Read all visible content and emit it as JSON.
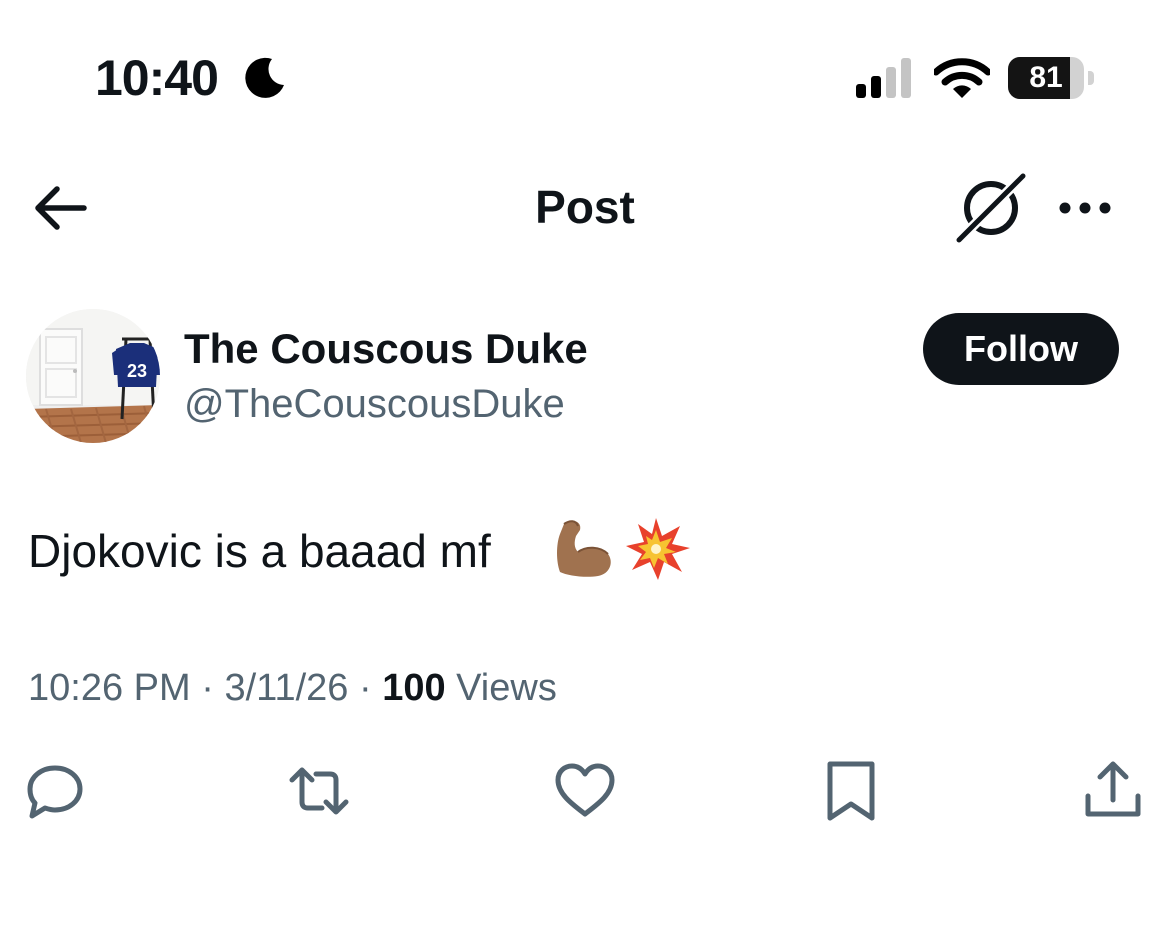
{
  "status_bar": {
    "time": "10:40",
    "focus_icon": "moon-icon",
    "signal_icon": "cellular-signal-icon",
    "wifi_icon": "wifi-icon",
    "battery_percent": "81",
    "battery_level": 0.81
  },
  "nav": {
    "back_icon": "back-arrow-icon",
    "title": "Post",
    "grok_icon": "grok-icon",
    "more_icon": "more-dots-icon"
  },
  "author": {
    "display_name": "The Couscous Duke",
    "handle": "@TheCouscousDuke",
    "avatar_jersey_number": "23",
    "follow_label": "Follow"
  },
  "tweet": {
    "text": "Djokovic is a baaad mf",
    "emojis": [
      "flexed-biceps-icon",
      "collision-icon"
    ],
    "time": "10:26 PM",
    "sep1": " · ",
    "date": "3/11/26",
    "sep2": " · ",
    "views_count": "100",
    "views_label": " Views"
  },
  "actions": [
    {
      "name": "reply-icon"
    },
    {
      "name": "repost-icon"
    },
    {
      "name": "like-icon"
    },
    {
      "name": "bookmark-icon"
    },
    {
      "name": "share-icon"
    }
  ],
  "colors": {
    "text_primary": "#0f1419",
    "text_secondary": "#536471",
    "follow_bg": "#0f1419"
  }
}
